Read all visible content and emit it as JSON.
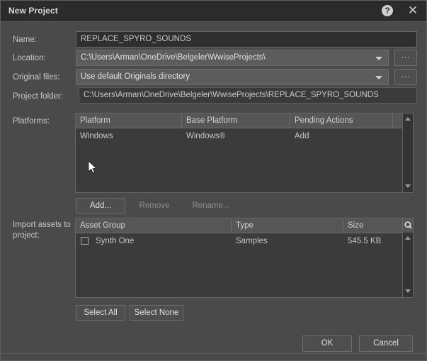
{
  "window": {
    "title": "New Project",
    "help_icon": "help-circle-icon",
    "close_icon": "close-icon"
  },
  "fields": {
    "name": {
      "label": "Name:",
      "value": "REPLACE_SPYRO_SOUNDS"
    },
    "location": {
      "label": "Location:",
      "value": "C:\\Users\\Arman\\OneDrive\\Belgeler\\WwiseProjects\\",
      "browse_label": "..."
    },
    "original_files": {
      "label": "Original files:",
      "value": "Use default Originals directory",
      "browse_label": "..."
    },
    "project_folder": {
      "label": "Project folder:",
      "value": "C:\\Users\\Arman\\OneDrive\\Belgeler\\WwiseProjects\\REPLACE_SPYRO_SOUNDS"
    }
  },
  "platforms": {
    "label": "Platforms:",
    "columns": [
      "Platform",
      "Base Platform",
      "Pending Actions"
    ],
    "rows": [
      {
        "platform": "Windows",
        "base_platform": "Windows®",
        "pending_actions": "Add"
      }
    ],
    "buttons": [
      {
        "label": "Add...",
        "enabled": true
      },
      {
        "label": "Remove",
        "enabled": false
      },
      {
        "label": "Rename...",
        "enabled": false
      }
    ]
  },
  "assets": {
    "label": "Import assets to\nproject:",
    "columns": [
      "Asset Group",
      "Type",
      "Size"
    ],
    "search_icon": "search-icon",
    "rows": [
      {
        "checked": false,
        "asset_group": "Synth One",
        "type": "Samples",
        "size": "545.5 KB"
      }
    ],
    "buttons": [
      {
        "label": "Select All"
      },
      {
        "label": "Select None"
      }
    ]
  },
  "footer": {
    "ok_label": "OK",
    "cancel_label": "Cancel"
  },
  "colors": {
    "dialog_bg": "#4a4a4a",
    "titlebar_bg": "#2b2b2b",
    "input_bg": "#2f2f2f",
    "combo_bg": "#5c5c5c",
    "table_bg": "#3b3b3b",
    "header_bg": "#565656",
    "text": "#c8c8c8"
  }
}
